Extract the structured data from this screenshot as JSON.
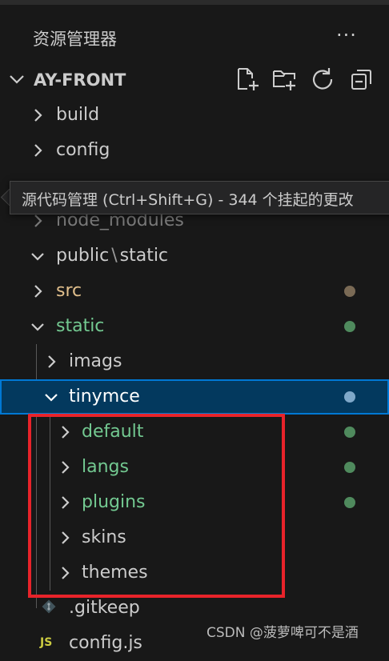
{
  "explorer": {
    "title": "资源管理器",
    "more_label": "···",
    "section_title": "AY-FRONT",
    "actions": [
      "new-file-icon",
      "new-folder-icon",
      "refresh-icon",
      "collapse-all-icon"
    ]
  },
  "tree": [
    {
      "label": "build",
      "color": "#cccccc"
    },
    {
      "label": "config",
      "color": "#cccccc"
    },
    {
      "label": "node_modules",
      "color": "#7a7a7a"
    },
    {
      "label": "public",
      "suffix": "static",
      "color": "#cccccc"
    },
    {
      "label": "src",
      "color": "#e2c08d",
      "decoration": "#7a6a55"
    },
    {
      "label": "static",
      "color": "#73c991",
      "decoration": "#4f8a5d"
    },
    {
      "label": "imags",
      "color": "#cccccc"
    },
    {
      "label": "tinymce",
      "color": "#ffffff",
      "decoration": "#7fa8c9"
    },
    {
      "label": "default",
      "color": "#73c991",
      "decoration": "#4f8a5d"
    },
    {
      "label": "langs",
      "color": "#73c991",
      "decoration": "#4f8a5d"
    },
    {
      "label": "plugins",
      "color": "#73c991",
      "decoration": "#4f8a5d"
    },
    {
      "label": "skins",
      "color": "#cccccc"
    },
    {
      "label": "themes",
      "color": "#cccccc"
    },
    {
      "label": ".gitkeep",
      "color": "#cccccc"
    },
    {
      "label": "config.js",
      "color": "#cccccc",
      "icon_text": "JS"
    }
  ],
  "tooltip": {
    "text": "源代码管理 (Ctrl+Shift+G) - 344 个挂起的更改"
  },
  "watermark": "CSDN @菠萝啤可不是酒"
}
